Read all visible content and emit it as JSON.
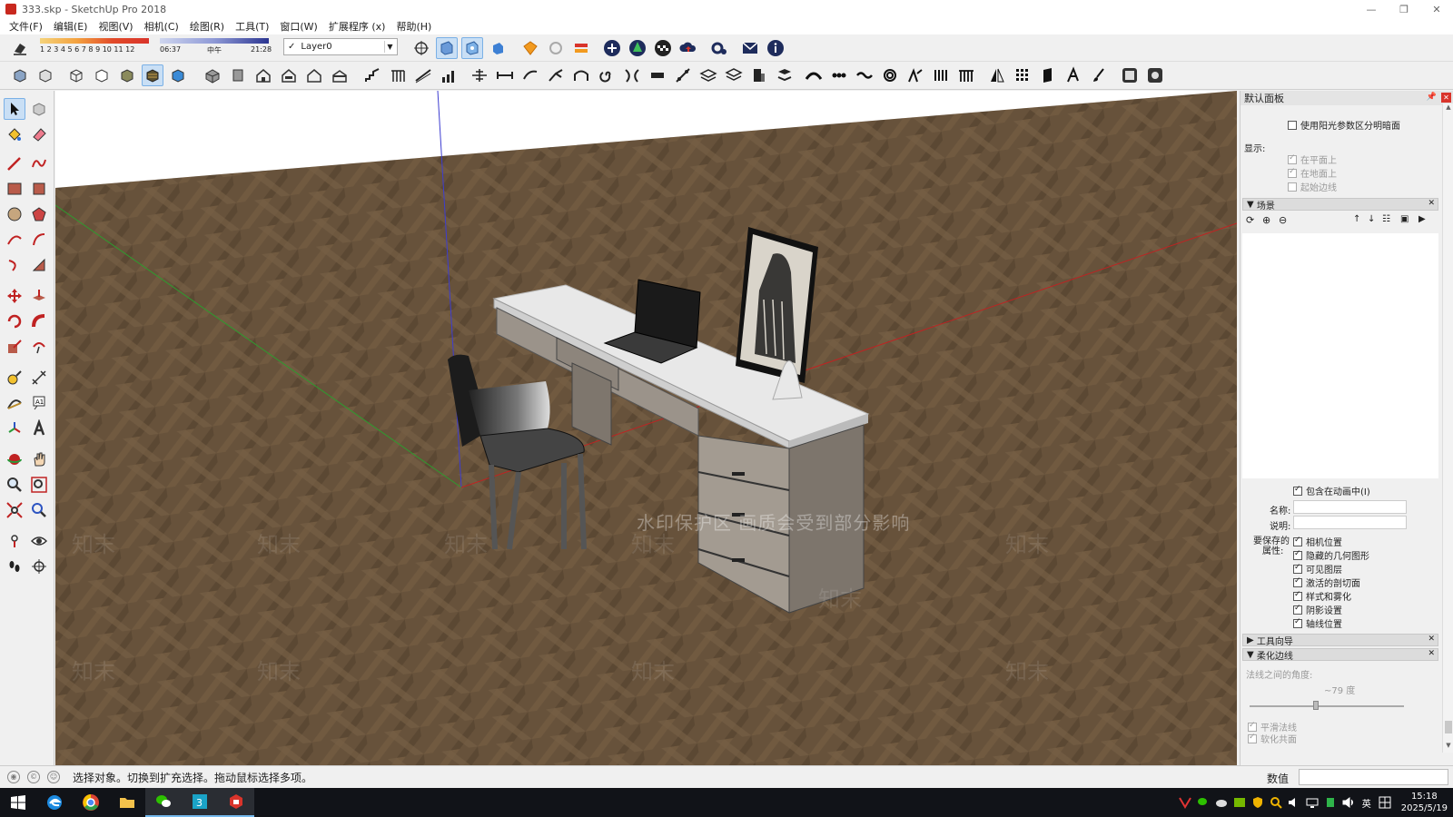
{
  "window": {
    "title": "333.skp - SketchUp Pro 2018",
    "controls": [
      "—",
      "❐",
      "✕"
    ]
  },
  "menu": [
    "文件(F)",
    "编辑(E)",
    "视图(V)",
    "相机(C)",
    "绘图(R)",
    "工具(T)",
    "窗口(W)",
    "扩展程序 (x)",
    "帮助(H)"
  ],
  "toolbar": {
    "shadow_month_ticks": "1 2 3 4 5 6 7 8 9 10 11 12",
    "shadow_time_start": "06:37",
    "shadow_time_mid": "中午",
    "shadow_time_end": "21:28",
    "layer_name": "Layer0"
  },
  "viewport": {
    "watermark": "水印保护区   画质会受到部分影响",
    "wm_text": "知末"
  },
  "panel": {
    "title": "默认面板",
    "use_sun_label": "使用阳光参数区分明暗面",
    "display_label": "显示:",
    "display_opts": [
      "在平面上",
      "在地面上",
      "起始边线"
    ],
    "scenes_label": "场景",
    "include_animation": "包含在动画中(I)",
    "name_label": "名称:",
    "desc_label": "说明:",
    "props_label_1": "要保存的",
    "props_label_2": "属性:",
    "props": [
      "相机位置",
      "隐藏的几何图形",
      "可见图层",
      "激活的剖切面",
      "样式和雾化",
      "阴影设置",
      "轴线位置"
    ],
    "instructor_label": "工具向导",
    "soften_label": "柔化边线",
    "angle_label": "法线之间的角度:",
    "angle_value": "~79 度",
    "smooth_normals": "平滑法线",
    "soften_coplanar": "软化共面"
  },
  "status": {
    "message": "选择对象。切换到扩充选择。拖动鼠标选择多项。",
    "value_label": "数值"
  },
  "taskbar": {
    "lang": "英",
    "time": "15:18",
    "date": "2025/5/19"
  }
}
